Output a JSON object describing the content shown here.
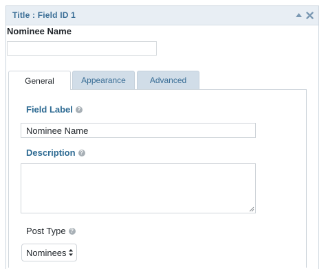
{
  "panel": {
    "title": "Title : Field ID 1",
    "collapse_icon": "triangle-up-icon",
    "close_icon": "close-icon"
  },
  "nominee": {
    "label": "Nominee Name",
    "value": ""
  },
  "tabs": [
    {
      "label": "General",
      "active": true
    },
    {
      "label": "Appearance",
      "active": false
    },
    {
      "label": "Advanced",
      "active": false
    }
  ],
  "general": {
    "field_label": {
      "label": "Field Label",
      "help": "?",
      "value": "Nominee Name"
    },
    "description": {
      "label": "Description",
      "help": "?",
      "value": ""
    },
    "post_type": {
      "label": "Post Type",
      "help": "?",
      "selected": "Nominees"
    }
  },
  "colors": {
    "accent": "#2d6a92",
    "header_bg": "#e8eef4",
    "inactive_tab_bg": "#d1dde8"
  }
}
